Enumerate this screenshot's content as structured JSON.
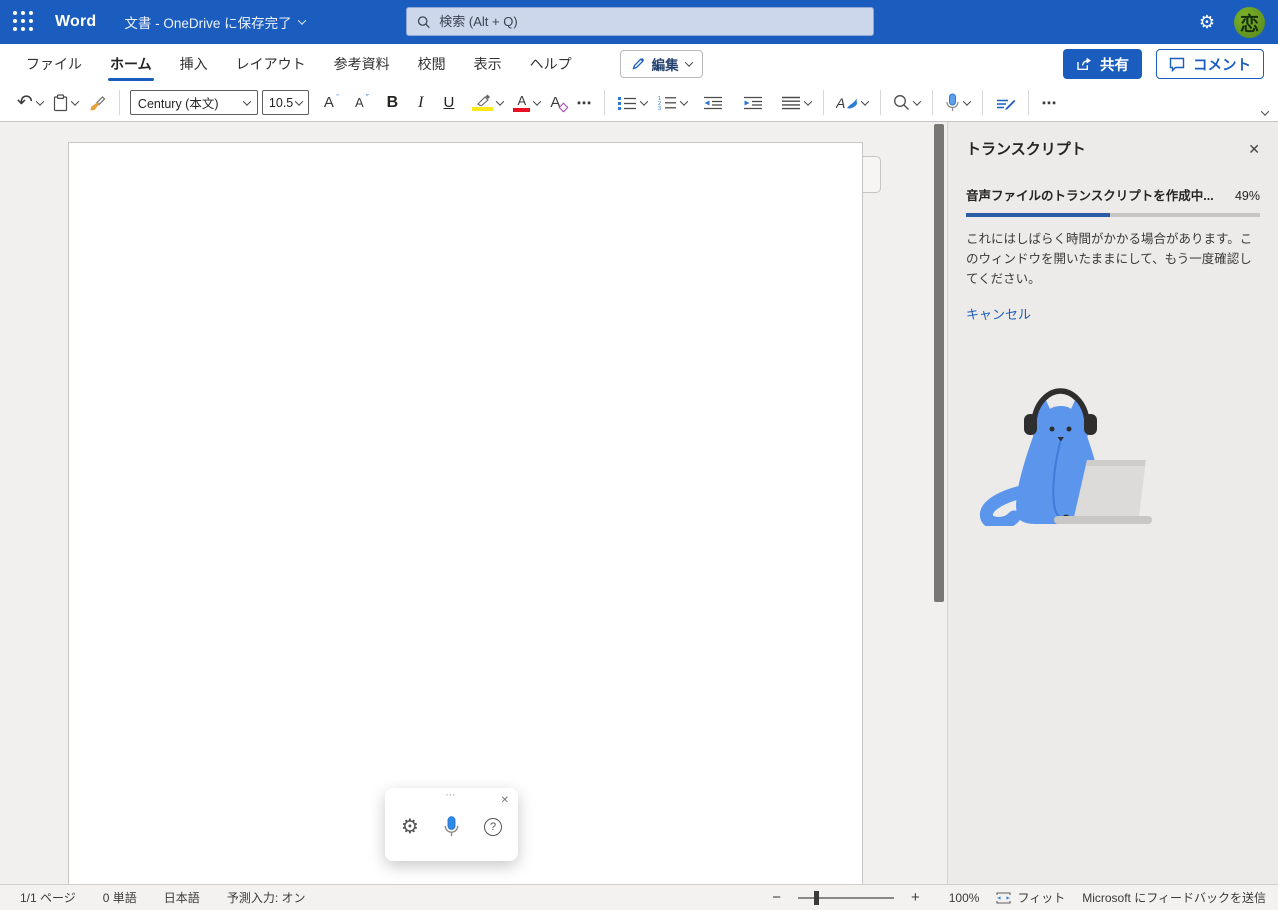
{
  "topbar": {
    "app_name": "Word",
    "doc_title": "文書 - OneDrive に保存完了",
    "search_placeholder": "検索 (Alt + Q)"
  },
  "avatar": {
    "glyph": "恋"
  },
  "icons": {
    "gear_glyph": "⚙",
    "close_glyph": "✕",
    "more_glyph": "⋯",
    "undo_glyph": "↶",
    "help_glyph": "?",
    "handle_glyph": "⋯",
    "caret_up": "ˆ",
    "caret_down": "ˇ"
  },
  "tabs": {
    "items": [
      {
        "label": "ファイル"
      },
      {
        "label": "ホーム"
      },
      {
        "label": "挿入"
      },
      {
        "label": "レイアウト"
      },
      {
        "label": "参考資料"
      },
      {
        "label": "校閲"
      },
      {
        "label": "表示"
      },
      {
        "label": "ヘルプ"
      }
    ],
    "active": "ホーム",
    "edit_label": "編集",
    "share_label": "共有",
    "comment_label": "コメント"
  },
  "toolbar": {
    "font_name": "Century (本文)",
    "font_size": "10.5",
    "letters": {
      "a": "A",
      "b": "B",
      "i": "I",
      "u": "U"
    }
  },
  "panel": {
    "title": "トランスクリプト",
    "progress_label": "音声ファイルのトランスクリプトを作成中...",
    "progress_percent": "49%",
    "body_text": "これにはしばらく時間がかかる場合があります。このウィンドウを開いたままにして、もう一度確認してください。",
    "cancel_label": "キャンセル"
  },
  "statusbar": {
    "page_count": "1/1 ページ",
    "word_count": "0 単語",
    "language": "日本語",
    "ime": "予測入力: オン",
    "zoom_out": "−",
    "zoom_in": "+",
    "zoom_level": "100%",
    "fit_label": "フィット",
    "feedback_label": "Microsoft にフィードバックを送信"
  },
  "colors": {
    "brand_blue": "#1a5dbe",
    "accent_blue": "#2b79d7",
    "progress_fill": "#2b5aa6",
    "highlight_yellow": "#ffe81a",
    "font_color_red": "#e81123",
    "cat_blue": "#5b95ec"
  }
}
